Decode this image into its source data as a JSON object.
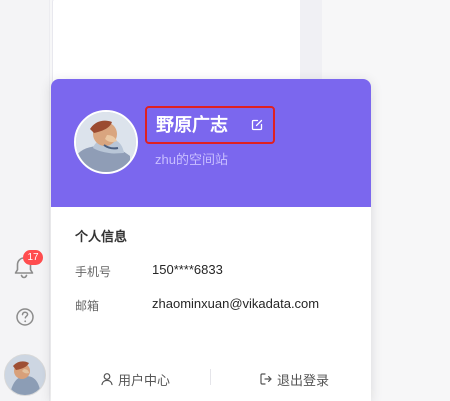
{
  "left_rail": {
    "notification_count": "17",
    "icons": [
      "bell-icon",
      "help-icon",
      "avatar"
    ]
  },
  "profile": {
    "name": "野原广志",
    "space": "zhu的空间站",
    "edit_icon": "edit-icon"
  },
  "info": {
    "title": "个人信息",
    "phone_label": "手机号",
    "phone_value": "150****6833",
    "email_label": "邮箱",
    "email_value": "zhaominxuan@vikadata.com"
  },
  "footer": {
    "user_center": "用户中心",
    "logout": "退出登录"
  },
  "colors": {
    "header_bg": "#7b67ee",
    "badge_bg": "#ff4d4f",
    "highlight_border": "#e02020"
  }
}
